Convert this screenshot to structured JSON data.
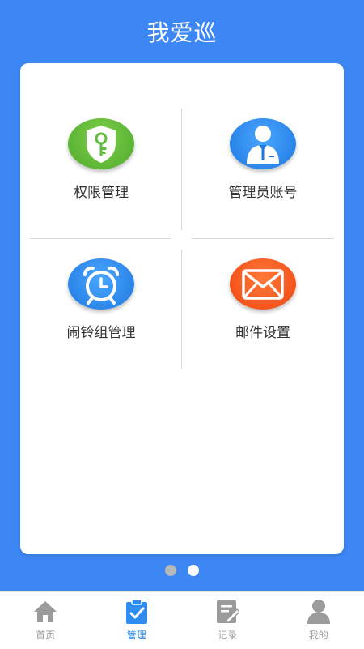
{
  "header": {
    "title": "我爱巡"
  },
  "menu": {
    "items": [
      {
        "label": "权限管理",
        "icon": "shield-key-icon",
        "color": "#5fbf3c"
      },
      {
        "label": "管理员账号",
        "icon": "admin-person-icon",
        "color": "#2f8cf0"
      },
      {
        "label": "闹铃组管理",
        "icon": "alarm-clock-icon",
        "color": "#2f8cf0"
      },
      {
        "label": "邮件设置",
        "icon": "mail-envelope-icon",
        "color": "#ff5a1f"
      }
    ]
  },
  "pager": {
    "count": 2,
    "active_index": 1,
    "colors": {
      "inactive": "#b8b8b8",
      "active": "#ffffff"
    }
  },
  "tabbar": {
    "items": [
      {
        "label": "首页",
        "icon": "home-icon",
        "active": false
      },
      {
        "label": "管理",
        "icon": "clipboard-check-icon",
        "active": true
      },
      {
        "label": "记录",
        "icon": "record-notebook-icon",
        "active": false
      },
      {
        "label": "我的",
        "icon": "user-icon",
        "active": false
      }
    ],
    "colors": {
      "active": "#2f8cf0",
      "inactive": "#9b9b9b"
    }
  },
  "colors": {
    "brand": "#3d87f5"
  }
}
